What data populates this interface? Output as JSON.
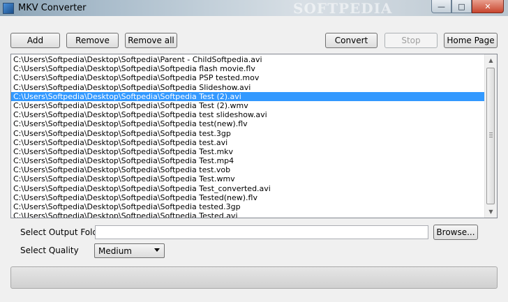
{
  "window": {
    "title": "MKV Converter",
    "watermark": "SOFTPEDIA"
  },
  "toolbar": {
    "add_label": "Add",
    "remove_label": "Remove",
    "remove_all_label": "Remove all",
    "convert_label": "Convert",
    "stop_label": "Stop",
    "home_page_label": "Home Page"
  },
  "files": [
    "C:\\Users\\Softpedia\\Desktop\\Softpedia\\Parent - ChildSoftpedia.avi",
    "C:\\Users\\Softpedia\\Desktop\\Softpedia\\Softpedia flash movie.flv",
    "C:\\Users\\Softpedia\\Desktop\\Softpedia\\Softpedia PSP tested.mov",
    "C:\\Users\\Softpedia\\Desktop\\Softpedia\\Softpedia Slideshow.avi",
    "C:\\Users\\Softpedia\\Desktop\\Softpedia\\Softpedia Test (2).avi",
    "C:\\Users\\Softpedia\\Desktop\\Softpedia\\Softpedia Test (2).wmv",
    "C:\\Users\\Softpedia\\Desktop\\Softpedia\\Softpedia test slideshow.avi",
    "C:\\Users\\Softpedia\\Desktop\\Softpedia\\Softpedia test(new).flv",
    "C:\\Users\\Softpedia\\Desktop\\Softpedia\\Softpedia test.3gp",
    "C:\\Users\\Softpedia\\Desktop\\Softpedia\\Softpedia test.avi",
    "C:\\Users\\Softpedia\\Desktop\\Softpedia\\Softpedia Test.mkv",
    "C:\\Users\\Softpedia\\Desktop\\Softpedia\\Softpedia Test.mp4",
    "C:\\Users\\Softpedia\\Desktop\\Softpedia\\Softpedia test.vob",
    "C:\\Users\\Softpedia\\Desktop\\Softpedia\\Softpedia Test.wmv",
    "C:\\Users\\Softpedia\\Desktop\\Softpedia\\Softpedia Test_converted.avi",
    "C:\\Users\\Softpedia\\Desktop\\Softpedia\\Softpedia Tested(new).flv",
    "C:\\Users\\Softpedia\\Desktop\\Softpedia\\Softpedia tested.3gp",
    "C:\\Users\\Softpedia\\Desktop\\Softpedia\\Softpedia Tested.avi"
  ],
  "selected_index": 4,
  "output": {
    "folder_label": "Select Output Folder",
    "folder_value": "",
    "browse_label": "Browse..."
  },
  "quality": {
    "label": "Select Quality",
    "selected": "Medium"
  },
  "progress": {
    "value": 0
  },
  "colors": {
    "selection": "#3399ff",
    "close_button": "#c8452e"
  }
}
